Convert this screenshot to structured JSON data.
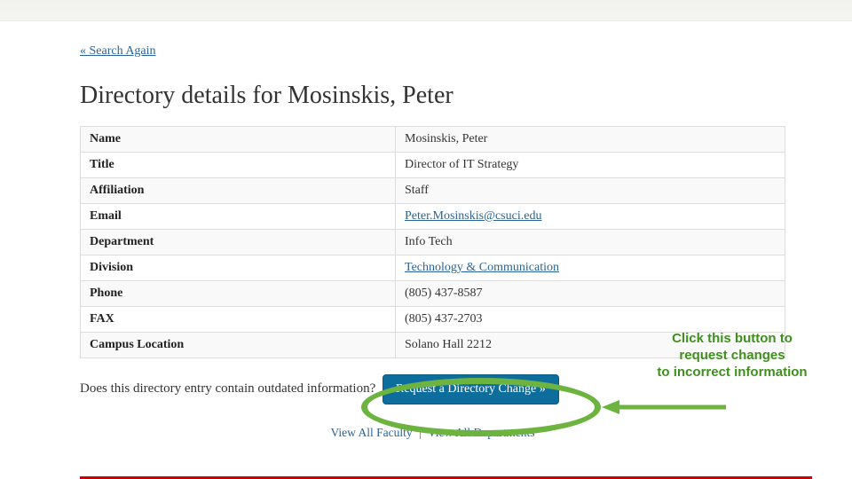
{
  "nav": {
    "search_again": "« Search Again"
  },
  "heading": "Directory details for Mosinskis, Peter",
  "details": {
    "rows": [
      {
        "label": "Name",
        "value": "Mosinskis, Peter",
        "link": false
      },
      {
        "label": "Title",
        "value": "Director of IT Strategy",
        "link": false
      },
      {
        "label": "Affiliation",
        "value": "Staff",
        "link": false
      },
      {
        "label": "Email",
        "value": "Peter.Mosinskis@csuci.edu",
        "link": true
      },
      {
        "label": "Department",
        "value": "Info Tech",
        "link": false
      },
      {
        "label": "Division",
        "value": "Technology & Communication",
        "link": true
      },
      {
        "label": "Phone",
        "value": "(805) 437-8587",
        "link": false
      },
      {
        "label": "FAX",
        "value": "(805) 437-2703",
        "link": false
      },
      {
        "label": "Campus Location",
        "value": "Solano Hall 2212",
        "link": false
      }
    ]
  },
  "prompt": {
    "text": "Does this directory entry contain outdated information?",
    "button": "Request a Directory Change »"
  },
  "footer": {
    "link1": "View All Faculty",
    "divider": "|",
    "link2": "View All Departments"
  },
  "annotation": {
    "line1": "Click this button to",
    "line2": "request changes",
    "line3": "to incorrect information"
  }
}
